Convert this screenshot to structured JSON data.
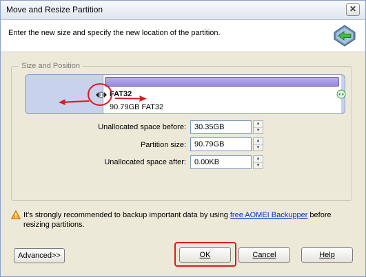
{
  "window": {
    "title": "Move and Resize Partition",
    "close_symbol": "✕"
  },
  "header": {
    "instruction": "Enter the new size and specify the new location of the partition.",
    "icon": "back-arrow-icon"
  },
  "group": {
    "legend": "Size and Position"
  },
  "partition": {
    "name": "FAT32",
    "size_label": "90.79GB FAT32",
    "handle_left_icon": "resize-handle-icon",
    "handle_right_icon": "resize-handle-icon"
  },
  "fields": {
    "unallocated_before_label": "Unallocated space before:",
    "unallocated_before_value": "30.35GB",
    "partition_size_label": "Partition size:",
    "partition_size_value": "90.79GB",
    "unallocated_after_label": "Unallocated space after:",
    "unallocated_after_value": "0.00KB"
  },
  "warning": {
    "text_before": "It's strongly recommended to backup important data by using ",
    "link": "free AOMEI Backupper",
    "text_after": " before resizing partitions.",
    "icon": "warning-icon"
  },
  "buttons": {
    "advanced": "Advanced>>",
    "ok": "OK",
    "cancel": "Cancel",
    "help": "Help"
  },
  "colors": {
    "annotation_red": "#e01818",
    "partition_strip": "#9689dc",
    "link": "#0033cc"
  }
}
